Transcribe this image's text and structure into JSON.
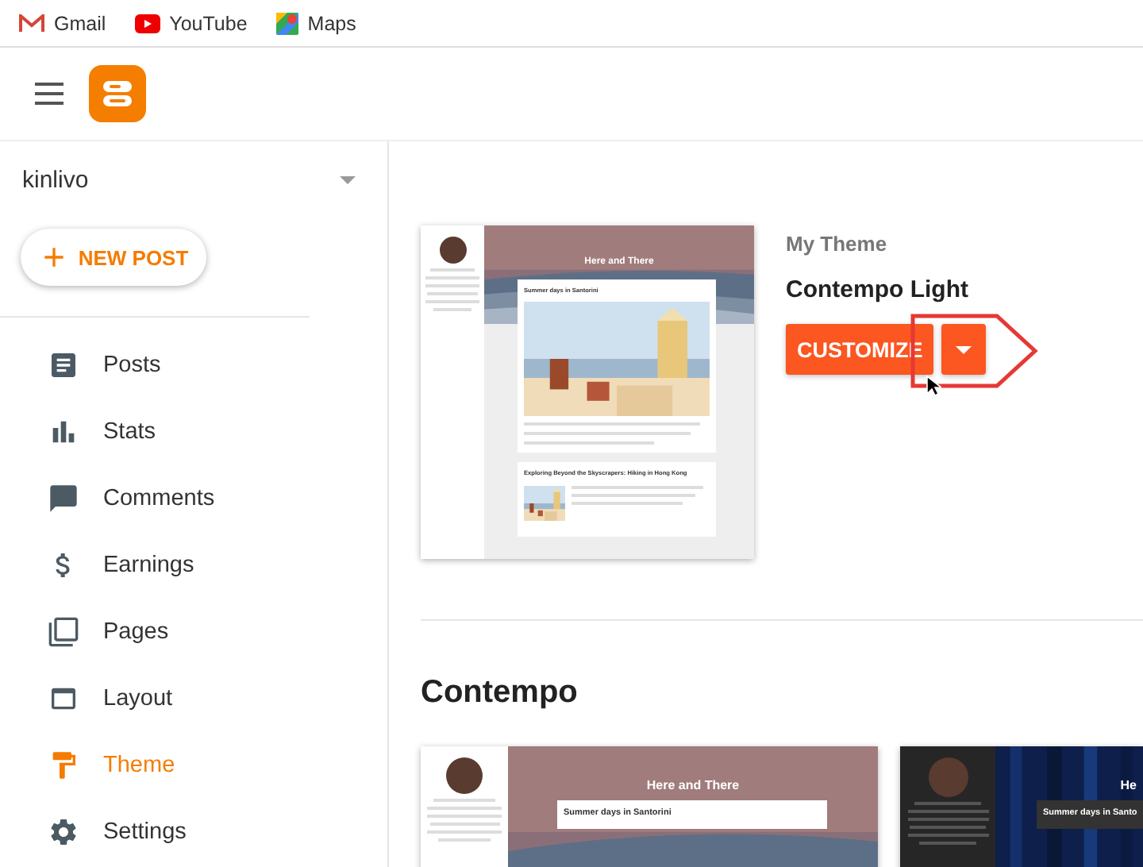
{
  "bookmarks": [
    {
      "kind": "gmail",
      "label": "Gmail"
    },
    {
      "kind": "youtube",
      "label": "YouTube"
    },
    {
      "kind": "maps",
      "label": "Maps"
    }
  ],
  "blog": {
    "name": "kinlivo"
  },
  "new_post": {
    "label": "NEW POST"
  },
  "nav": [
    {
      "kind": "posts",
      "label": "Posts",
      "selected": false
    },
    {
      "kind": "stats",
      "label": "Stats",
      "selected": false
    },
    {
      "kind": "comments",
      "label": "Comments",
      "selected": false
    },
    {
      "kind": "earnings",
      "label": "Earnings",
      "selected": false
    },
    {
      "kind": "pages",
      "label": "Pages",
      "selected": false
    },
    {
      "kind": "layout",
      "label": "Layout",
      "selected": false
    },
    {
      "kind": "theme",
      "label": "Theme",
      "selected": true
    },
    {
      "kind": "settings",
      "label": "Settings",
      "selected": false
    }
  ],
  "current_theme": {
    "caption": "My Theme",
    "name": "Contempo Light",
    "customize": "CUSTOMIZE",
    "preview": {
      "kind": "light",
      "blog_title": "Here and There",
      "posts": [
        "Summer days in Santorini",
        "Exploring Beyond the Skyscrapers: Hiking in Hong Kong"
      ]
    }
  },
  "gallery": {
    "title": "Contempo",
    "themes": [
      {
        "kind": "light",
        "blog_title": "Here and There",
        "posts": [
          "Summer days in Santorini"
        ]
      },
      {
        "kind": "dark",
        "blog_title": "He",
        "posts": [
          "Summer days in Santo"
        ]
      }
    ]
  }
}
